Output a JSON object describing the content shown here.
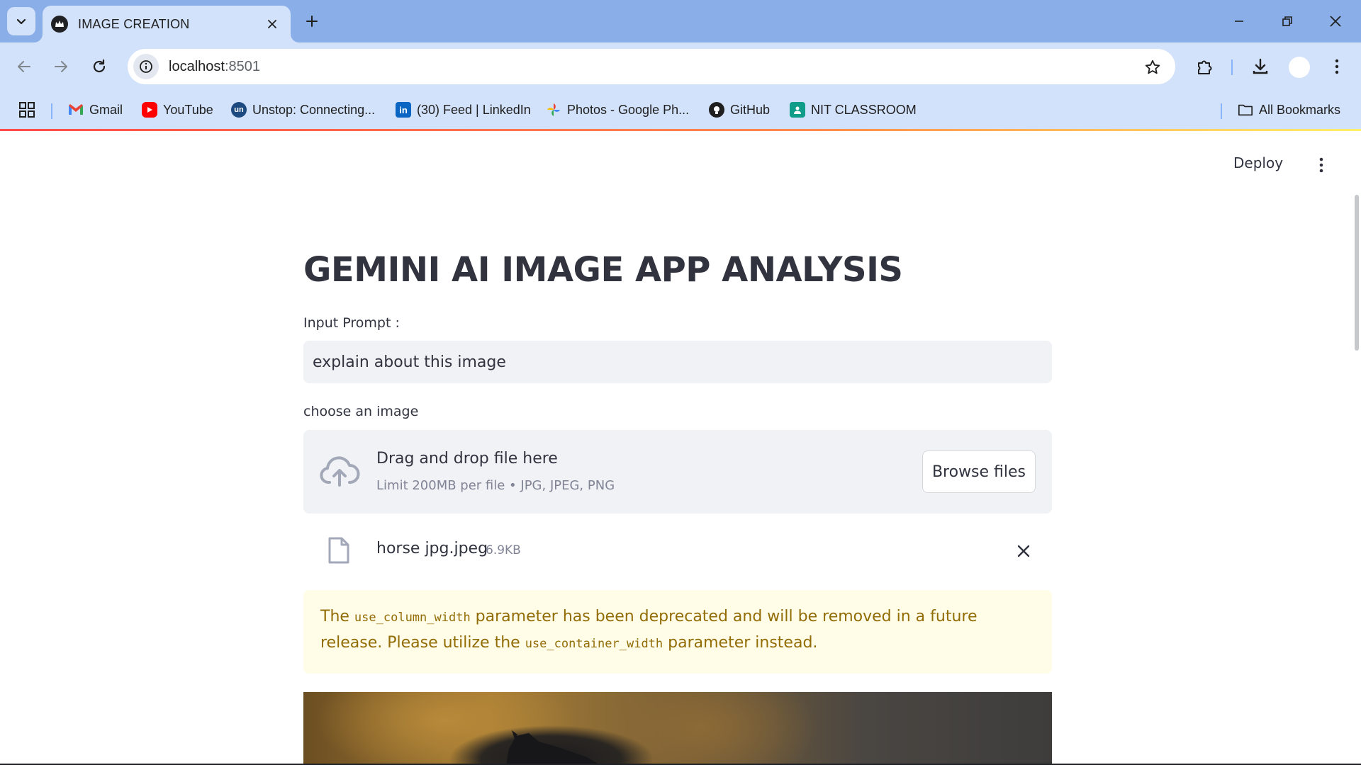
{
  "browser": {
    "tab_title": "IMAGE CREATION",
    "url_host": "localhost",
    "url_port": ":8501",
    "bookmarks": [
      {
        "label": "Gmail",
        "icon": "gmail-icon"
      },
      {
        "label": "YouTube",
        "icon": "youtube-icon"
      },
      {
        "label": "Unstop: Connecting...",
        "icon": "unstop-icon"
      },
      {
        "label": "(30) Feed | LinkedIn",
        "icon": "linkedin-icon"
      },
      {
        "label": "Photos - Google Ph...",
        "icon": "google-photos-icon"
      },
      {
        "label": "GitHub",
        "icon": "github-icon"
      },
      {
        "label": "NIT CLASSROOM",
        "icon": "classroom-icon"
      }
    ],
    "all_bookmarks": "All Bookmarks"
  },
  "app": {
    "deploy_label": "Deploy",
    "title": "GEMINI AI IMAGE APP ANALYSIS",
    "input_label": "Input Prompt :",
    "input_value": "explain about this image",
    "uploader_label": "choose an image",
    "dropzone_title": "Drag and drop file here",
    "dropzone_limit": "Limit 200MB per file • JPG, JPEG, PNG",
    "browse_label": "Browse files",
    "file_name": "horse jpg.jpeg",
    "file_size": "6.9KB",
    "warning": {
      "part1": "The ",
      "code1": "use_column_width",
      "part2": " parameter has been deprecated and will be removed in a future release. Please utilize the ",
      "code2": "use_container_width",
      "part3": " parameter instead."
    }
  },
  "colors": {
    "tabstrip": "#8aaee8",
    "toolbar": "#d3e2fb",
    "text": "#31333f",
    "input_bg": "#f0f2f6",
    "warning_bg": "#fffce7",
    "warning_text": "#926c05"
  }
}
